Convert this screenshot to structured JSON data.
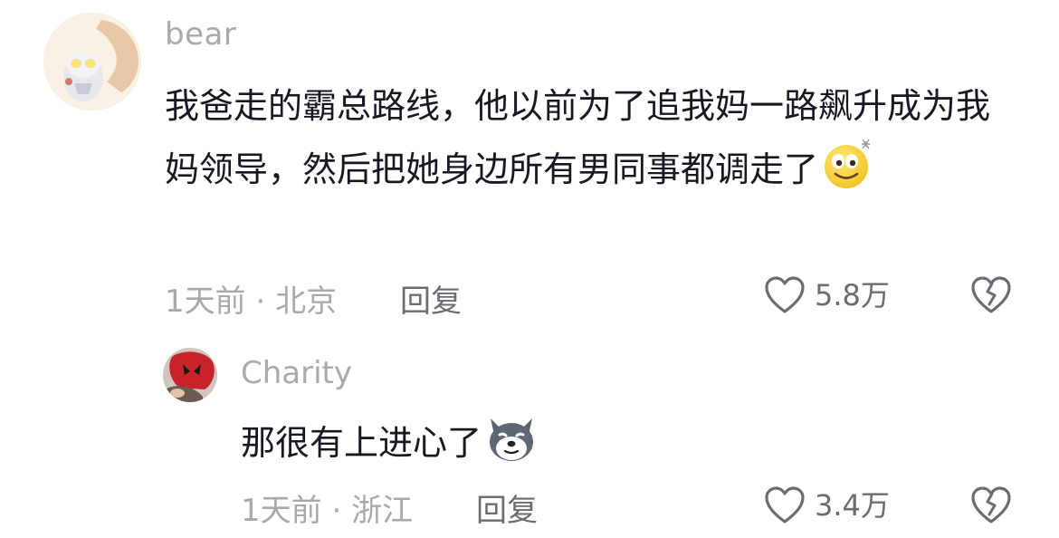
{
  "comments": [
    {
      "username": "bear",
      "text": "我爸走的霸总路线，他以前为了追我妈一路飙升成为我妈领导，然后把她身边所有男同事都调走了",
      "emoji": "dizzy-smile-emoji",
      "time": "1天前",
      "separator": "·",
      "location": "北京",
      "reply_label": "回复",
      "like_count": "5.8万"
    },
    {
      "username": "Charity",
      "text": "那很有上进心了",
      "emoji": "husky-dog-emoji",
      "time": "1天前",
      "separator": "·",
      "location": "浙江",
      "reply_label": "回复",
      "like_count": "3.4万"
    }
  ],
  "colors": {
    "primary_text": "#161823",
    "secondary_text": "#a9a9ad",
    "action_text": "#6b6c72"
  }
}
